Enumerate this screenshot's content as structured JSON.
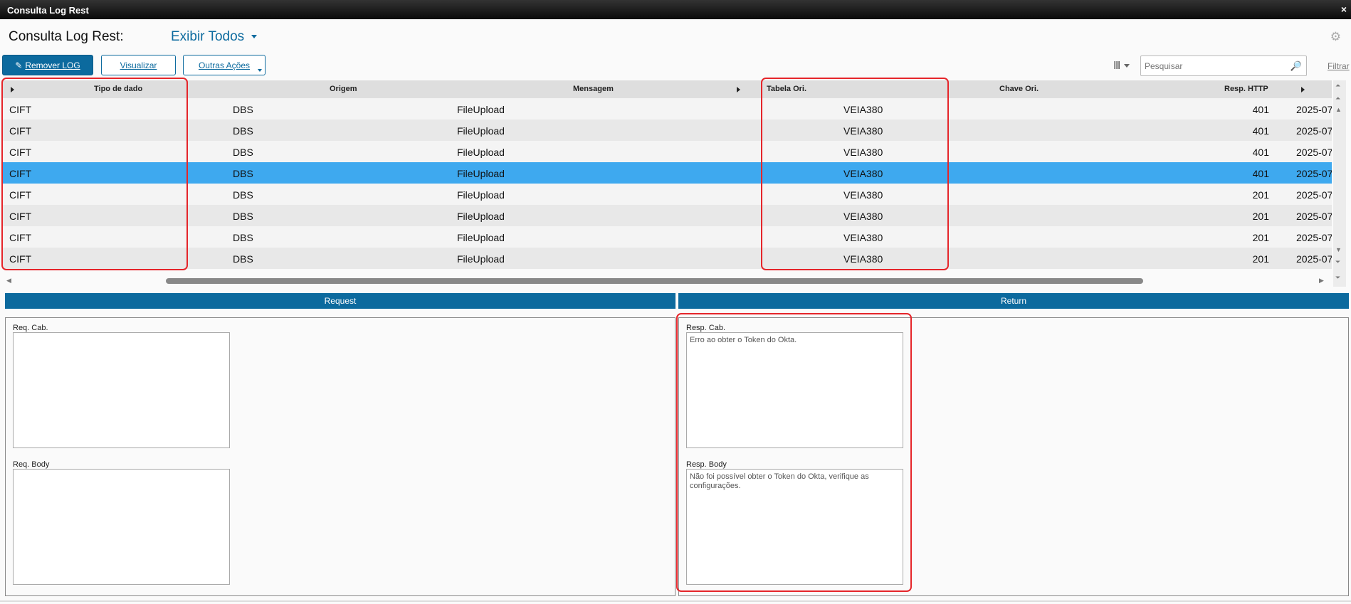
{
  "window": {
    "title": "Consulta Log Rest",
    "close": "×"
  },
  "header": {
    "title": "Consulta Log Rest:",
    "filter": "Exibir Todos"
  },
  "toolbar": {
    "remove_label": "Remover LOG",
    "view_label": "Visualizar",
    "more_label": "Outras Ações",
    "search_placeholder": "Pesquisar",
    "filter_label": "Filtrar"
  },
  "grid": {
    "columns": [
      "Tipo de dado",
      "Origem",
      "Mensagem",
      "Tabela Ori.",
      "Chave Ori.",
      "Resp. HTTP"
    ],
    "rows": [
      {
        "tipo": "CIFT",
        "origem": "DBS",
        "mensagem": "FileUpload",
        "tabela": "VEIA380",
        "chave": "",
        "http": "401",
        "data": "2025-07"
      },
      {
        "tipo": "CIFT",
        "origem": "DBS",
        "mensagem": "FileUpload",
        "tabela": "VEIA380",
        "chave": "",
        "http": "401",
        "data": "2025-07"
      },
      {
        "tipo": "CIFT",
        "origem": "DBS",
        "mensagem": "FileUpload",
        "tabela": "VEIA380",
        "chave": "",
        "http": "401",
        "data": "2025-07"
      },
      {
        "tipo": "CIFT",
        "origem": "DBS",
        "mensagem": "FileUpload",
        "tabela": "VEIA380",
        "chave": "",
        "http": "401",
        "data": "2025-07"
      },
      {
        "tipo": "CIFT",
        "origem": "DBS",
        "mensagem": "FileUpload",
        "tabela": "VEIA380",
        "chave": "",
        "http": "201",
        "data": "2025-07"
      },
      {
        "tipo": "CIFT",
        "origem": "DBS",
        "mensagem": "FileUpload",
        "tabela": "VEIA380",
        "chave": "",
        "http": "201",
        "data": "2025-07"
      },
      {
        "tipo": "CIFT",
        "origem": "DBS",
        "mensagem": "FileUpload",
        "tabela": "VEIA380",
        "chave": "",
        "http": "201",
        "data": "2025-07"
      },
      {
        "tipo": "CIFT",
        "origem": "DBS",
        "mensagem": "FileUpload",
        "tabela": "VEIA380",
        "chave": "",
        "http": "201",
        "data": "2025-07"
      }
    ],
    "selected_row": 3
  },
  "request": {
    "title": "Request",
    "cab_label": "Req. Cab.",
    "cab_value": "",
    "body_label": "Req. Body",
    "body_value": ""
  },
  "response": {
    "title": "Return",
    "cab_label": "Resp. Cab.",
    "cab_value": "Erro ao obter o Token do Okta.",
    "body_label": "Resp. Body",
    "body_value": "Não foi possível obter o Token do Okta, verifique as configurações."
  },
  "colors": {
    "primary": "#0c6a9e",
    "selected": "#3ea9ef",
    "highlight": "#e5252a"
  }
}
